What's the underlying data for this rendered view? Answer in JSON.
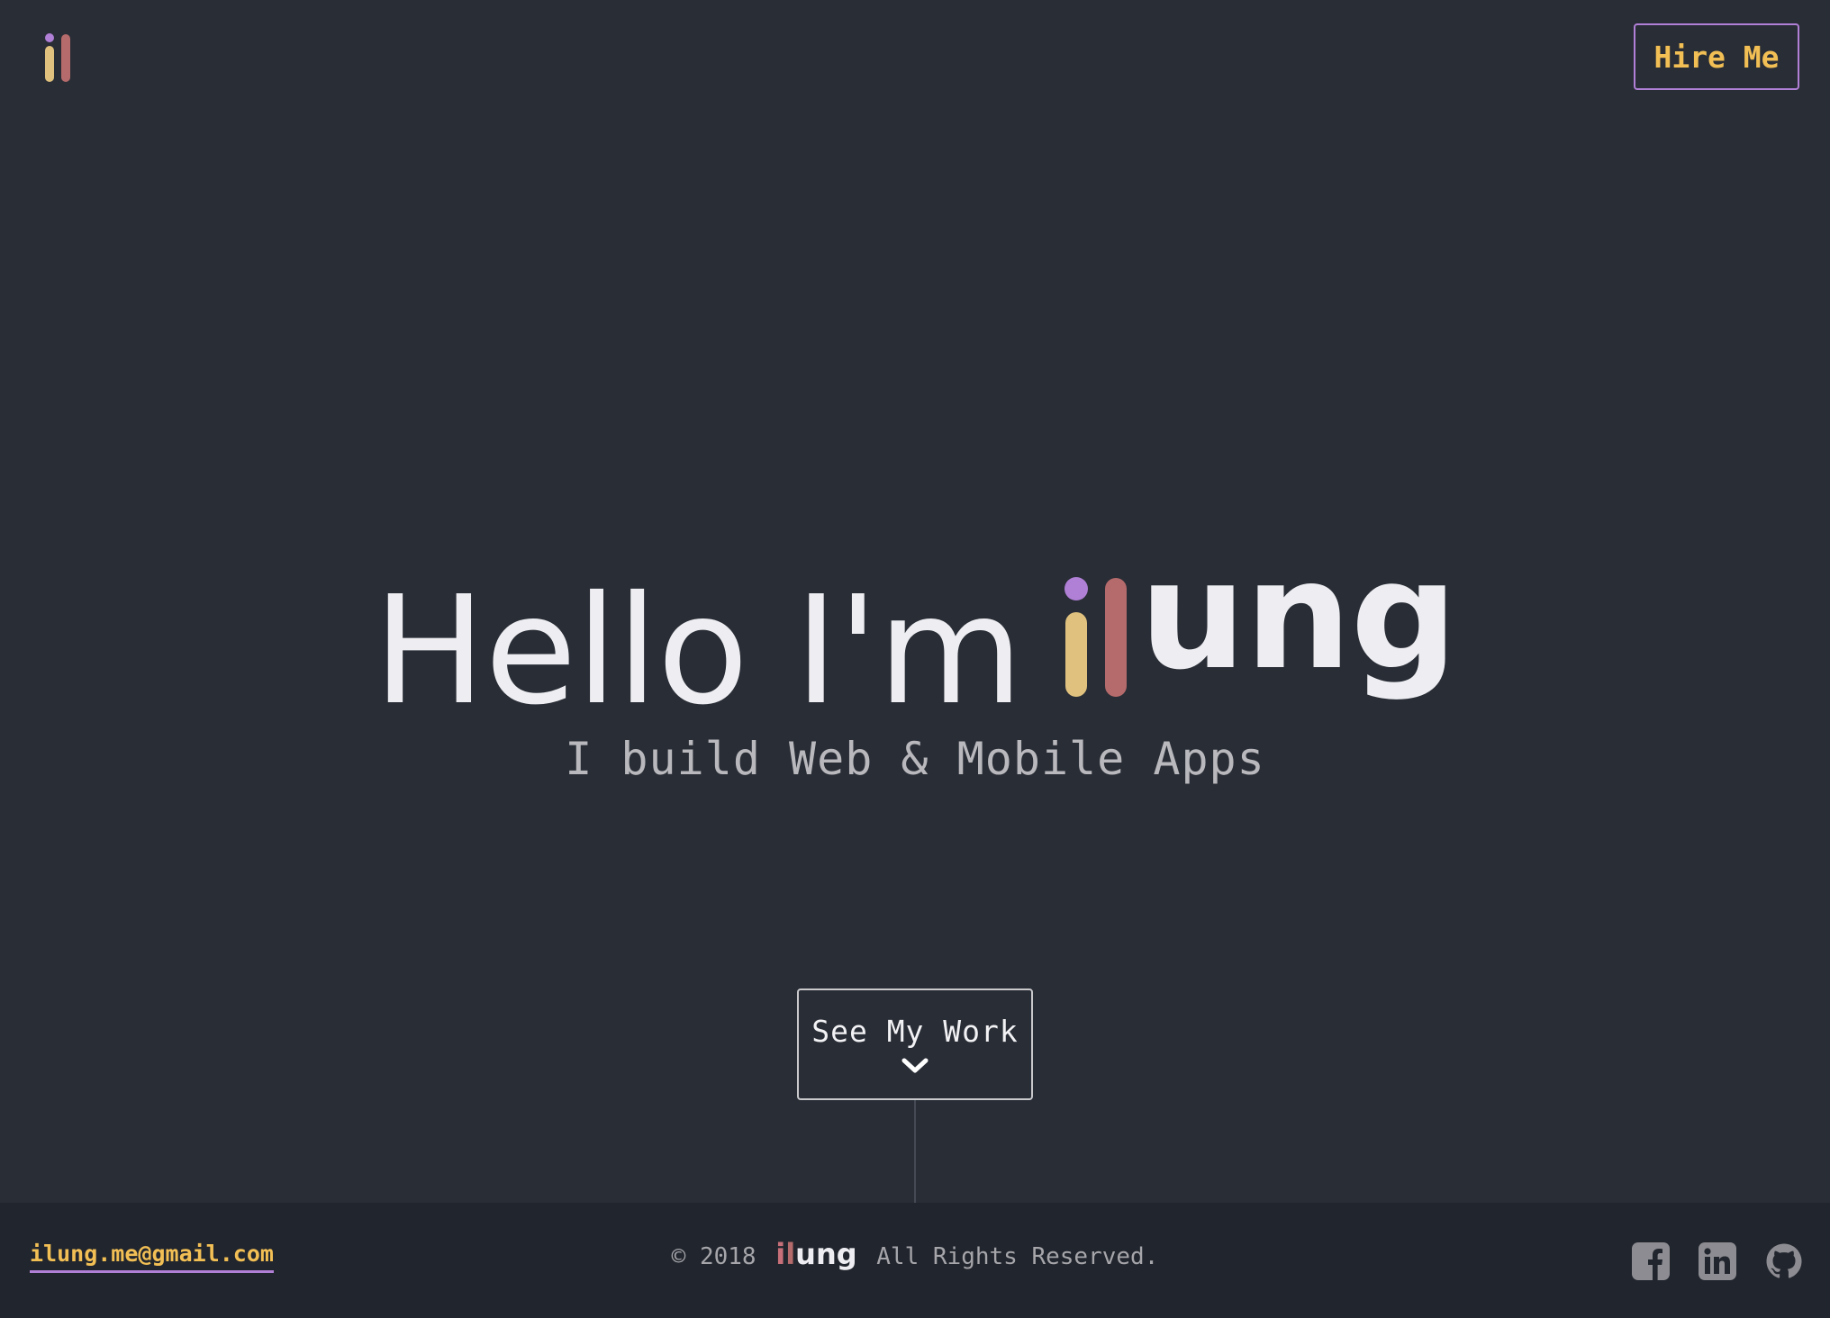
{
  "header": {
    "logo_icon": "il-logo-icon",
    "hire_label": "Hire Me"
  },
  "hero": {
    "greeting": "Hello I'm",
    "name_rest": "ung",
    "subtitle": "I build Web & Mobile Apps",
    "cta_label": "See My Work",
    "cta_icon": "chevron-down-icon"
  },
  "footer": {
    "email": "ilung.me@gmail.com",
    "copyright_prefix": "© 2018",
    "brand_i": "i",
    "brand_l": "l",
    "brand_rest": "ung",
    "copyright_suffix": "All Rights Reserved.",
    "socials": [
      "facebook-icon",
      "linkedin-icon",
      "github-icon"
    ]
  },
  "colors": {
    "background": "#292d36",
    "footer_background": "#21252d",
    "accent_yellow": "#f2bf55",
    "accent_purple": "#b07fd6",
    "brand_tan": "#e0c27e",
    "brand_rose": "#b56b6b"
  }
}
